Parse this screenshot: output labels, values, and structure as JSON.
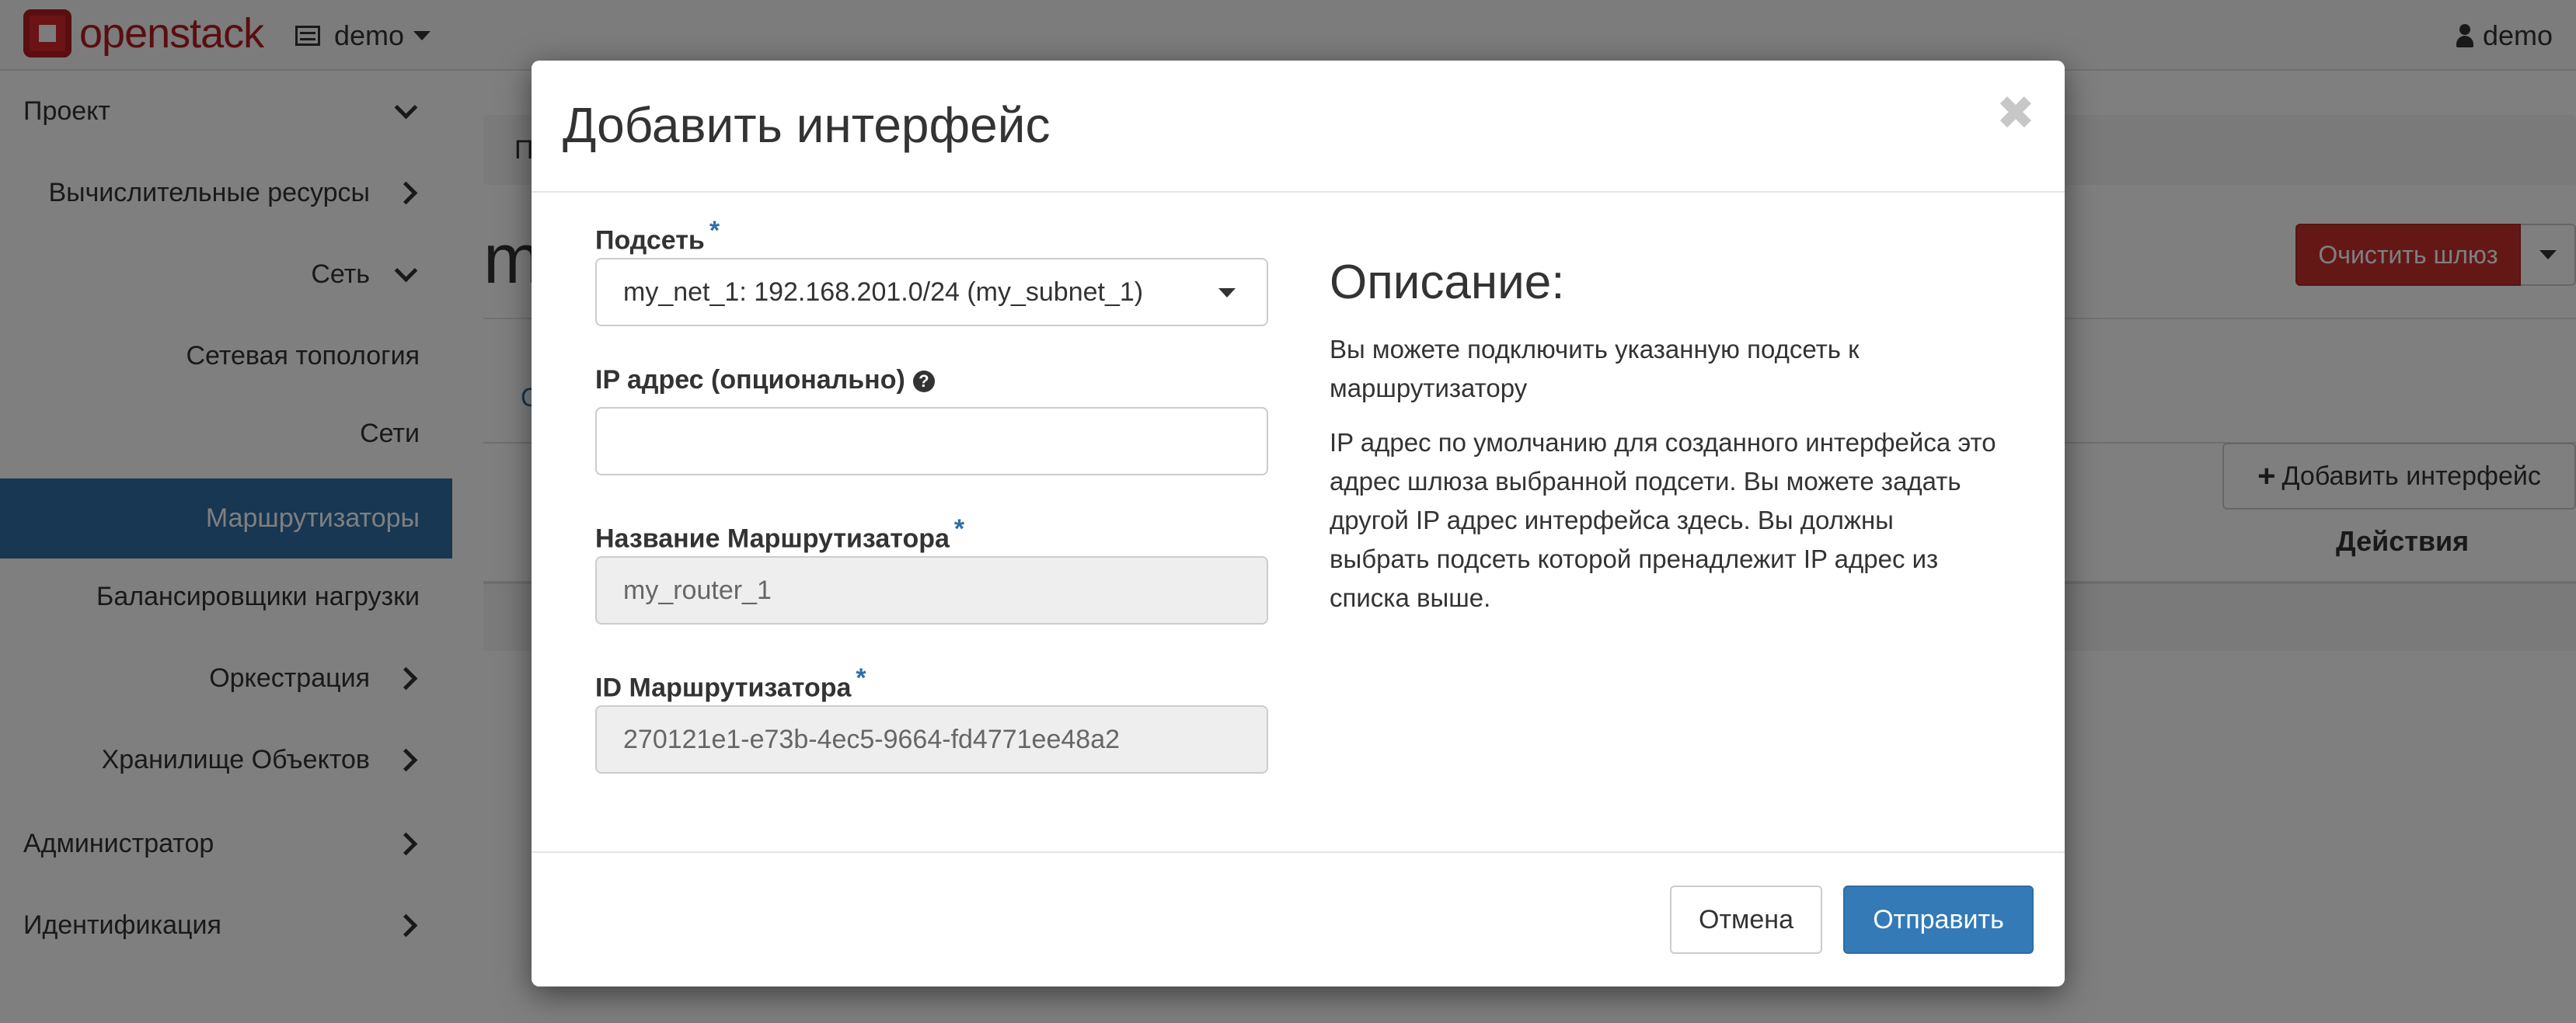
{
  "navbar": {
    "logo_text": "openstack",
    "project": "demo",
    "user": "demo"
  },
  "sidebar": {
    "items": [
      {
        "label": "Проект",
        "chevron": "down"
      },
      {
        "label": "Вычислительные ресурсы",
        "chevron": "right"
      },
      {
        "label": "Сеть",
        "chevron": "down"
      },
      {
        "label": "Сетевая топология"
      },
      {
        "label": "Сети"
      },
      {
        "label": "Маршрутизаторы",
        "active": true
      },
      {
        "label": "Балансировщики нагрузки"
      },
      {
        "label": "Оркестрация",
        "chevron": "right"
      },
      {
        "label": "Хранилище Объектов",
        "chevron": "right"
      },
      {
        "label": "Администратор",
        "chevron": "right"
      },
      {
        "label": "Идентификация",
        "chevron": "right"
      }
    ]
  },
  "main": {
    "breadcrumb": "П",
    "page_title": "m",
    "clear_gateway_label": "Очистить шлюз",
    "tab_stub": "О",
    "add_interface_label": "Добавить интерфейс",
    "actions_header": "Действия"
  },
  "modal": {
    "title": "Добавить интерфейс",
    "close_glyph": "✖",
    "fields": {
      "subnet": {
        "label": "Подсеть",
        "value": "my_net_1: 192.168.201.0/24 (my_subnet_1)"
      },
      "ip": {
        "label": "IP адрес (опционально)",
        "value": "",
        "placeholder": ""
      },
      "router_name": {
        "label": "Название Маршрутизатора",
        "value": "my_router_1"
      },
      "router_id": {
        "label": "ID Маршрутизатора",
        "value": "270121e1-e73b-4ec5-9664-fd4771ee48a2"
      }
    },
    "required_mark": "*",
    "description": {
      "title": "Описание:",
      "p1": "Вы можете подключить указанную подсеть к маршрутизатору",
      "p2": "IP адрес по умолчанию для созданного интерфейса это адрес шлюза выбранной подсети. Вы можете задать другой IP адрес интерфейса здесь. Вы должны выбрать подсеть которой пренадлежит IP адрес из списка выше."
    },
    "buttons": {
      "cancel": "Отмена",
      "submit": "Отправить"
    }
  },
  "colors": {
    "accent": "#337ab7",
    "sidebar_active": "#2f6ea7",
    "danger": "#c9302c",
    "brand": "#d6262b"
  }
}
